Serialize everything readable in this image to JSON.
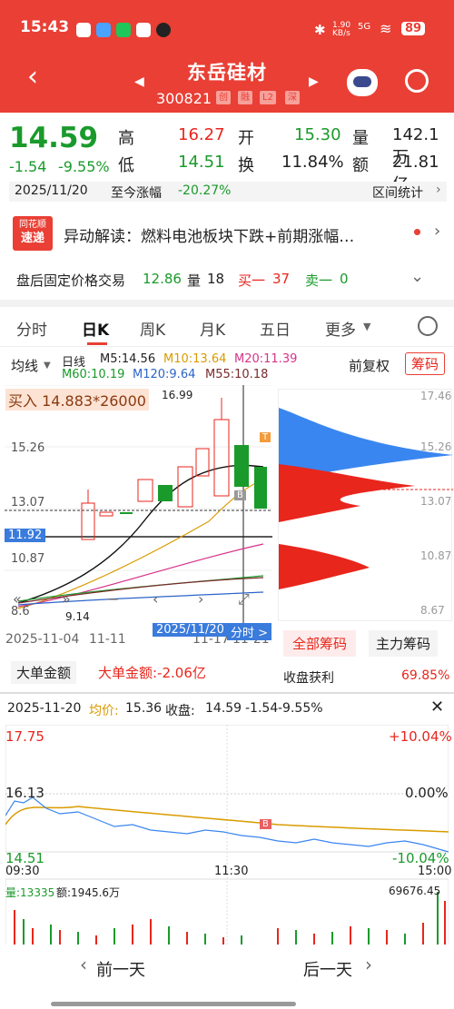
{
  "status": {
    "time": "15:43",
    "net": "1.90 KB/s",
    "signal": "5G",
    "battery": "89"
  },
  "header": {
    "name": "东岳硅材",
    "code": "300821",
    "tags": [
      "创",
      "融",
      "L2",
      "深"
    ]
  },
  "quote": {
    "price": "14.59",
    "change": "-1.54",
    "change_pct": "-9.55%",
    "high_label": "高",
    "high": "16.27",
    "open_label": "开",
    "open": "15.30",
    "vol_label": "量",
    "vol": "142.1万",
    "low_label": "低",
    "low": "14.51",
    "turnover_label": "换",
    "turnover": "11.84%",
    "amount_label": "额",
    "amount": "21.81亿"
  },
  "range": {
    "date": "2025/11/20",
    "label": "至今涨幅",
    "value": "-20.27%",
    "stats": "区间统计"
  },
  "banner": {
    "logo_top": "同花顺",
    "logo_bottom": "速递",
    "text": "异动解读：燃料电池板块下跌+前期涨幅…"
  },
  "afterhours": {
    "label": "盘后固定价格交易",
    "price": "12.86",
    "vol_label": "量",
    "vol": "18",
    "buy_label": "买一",
    "buy": "37",
    "sell_label": "卖一",
    "sell": "0"
  },
  "tabs": [
    "分时",
    "日K",
    "周K",
    "月K",
    "五日",
    "更多"
  ],
  "ma": {
    "selector": "均线",
    "period": "日线",
    "ma5": "M5:14.56",
    "ma10": "M10:13.64",
    "ma20": "M20:11.39",
    "ma60": "M60:10.19",
    "ma120": "M120:9.64",
    "ma55": "M55:10.18",
    "fq": "前复权",
    "chips": "筹码"
  },
  "kline": {
    "buy_note": "买入 14.883*26000",
    "high_note": "16.99",
    "low_note": "9.14",
    "y_labels": [
      "15.26",
      "13.07",
      "11.92",
      "10.87",
      "8.6"
    ],
    "dates": [
      "2025-11-04",
      "11-11",
      "11-17",
      "11-21"
    ],
    "cursor_date": "2025/11/20",
    "cursor_btn": "分时 >",
    "marker_b": "B",
    "marker_t": "T"
  },
  "chip_panel": {
    "y_labels": [
      "17.46",
      "15.26",
      "13.07",
      "10.87",
      "8.67"
    ],
    "tab_all": "全部筹码",
    "tab_main": "主力筹码",
    "profit_label": "收盘获利",
    "profit": "69.85%"
  },
  "bigorder": {
    "selector": "大单金额",
    "value": "大单金额:-2.06亿"
  },
  "intraday": {
    "date": "2025-11-20",
    "avg_label": "均价:",
    "avg": "15.36",
    "close_label": "收盘:",
    "close": "14.59",
    "chg": "-1.54",
    "chg_pct": "-9.55%",
    "y_max": "17.75",
    "y_mid": "16.13",
    "y_min": "14.51",
    "pct_max": "+10.04%",
    "pct_mid": "0.00%",
    "pct_min": "-10.04%",
    "t_start": "09:30",
    "t_mid": "11:30",
    "t_end": "15:00",
    "vol_text": "量:13335",
    "amt_text": "额:1945.6万",
    "vol_max": "69676.45",
    "marker_b": "B"
  },
  "nav": {
    "prev": "前一天",
    "next": "后一天"
  },
  "colors": {
    "red": "#e93f35",
    "green": "#1a9a2b"
  }
}
